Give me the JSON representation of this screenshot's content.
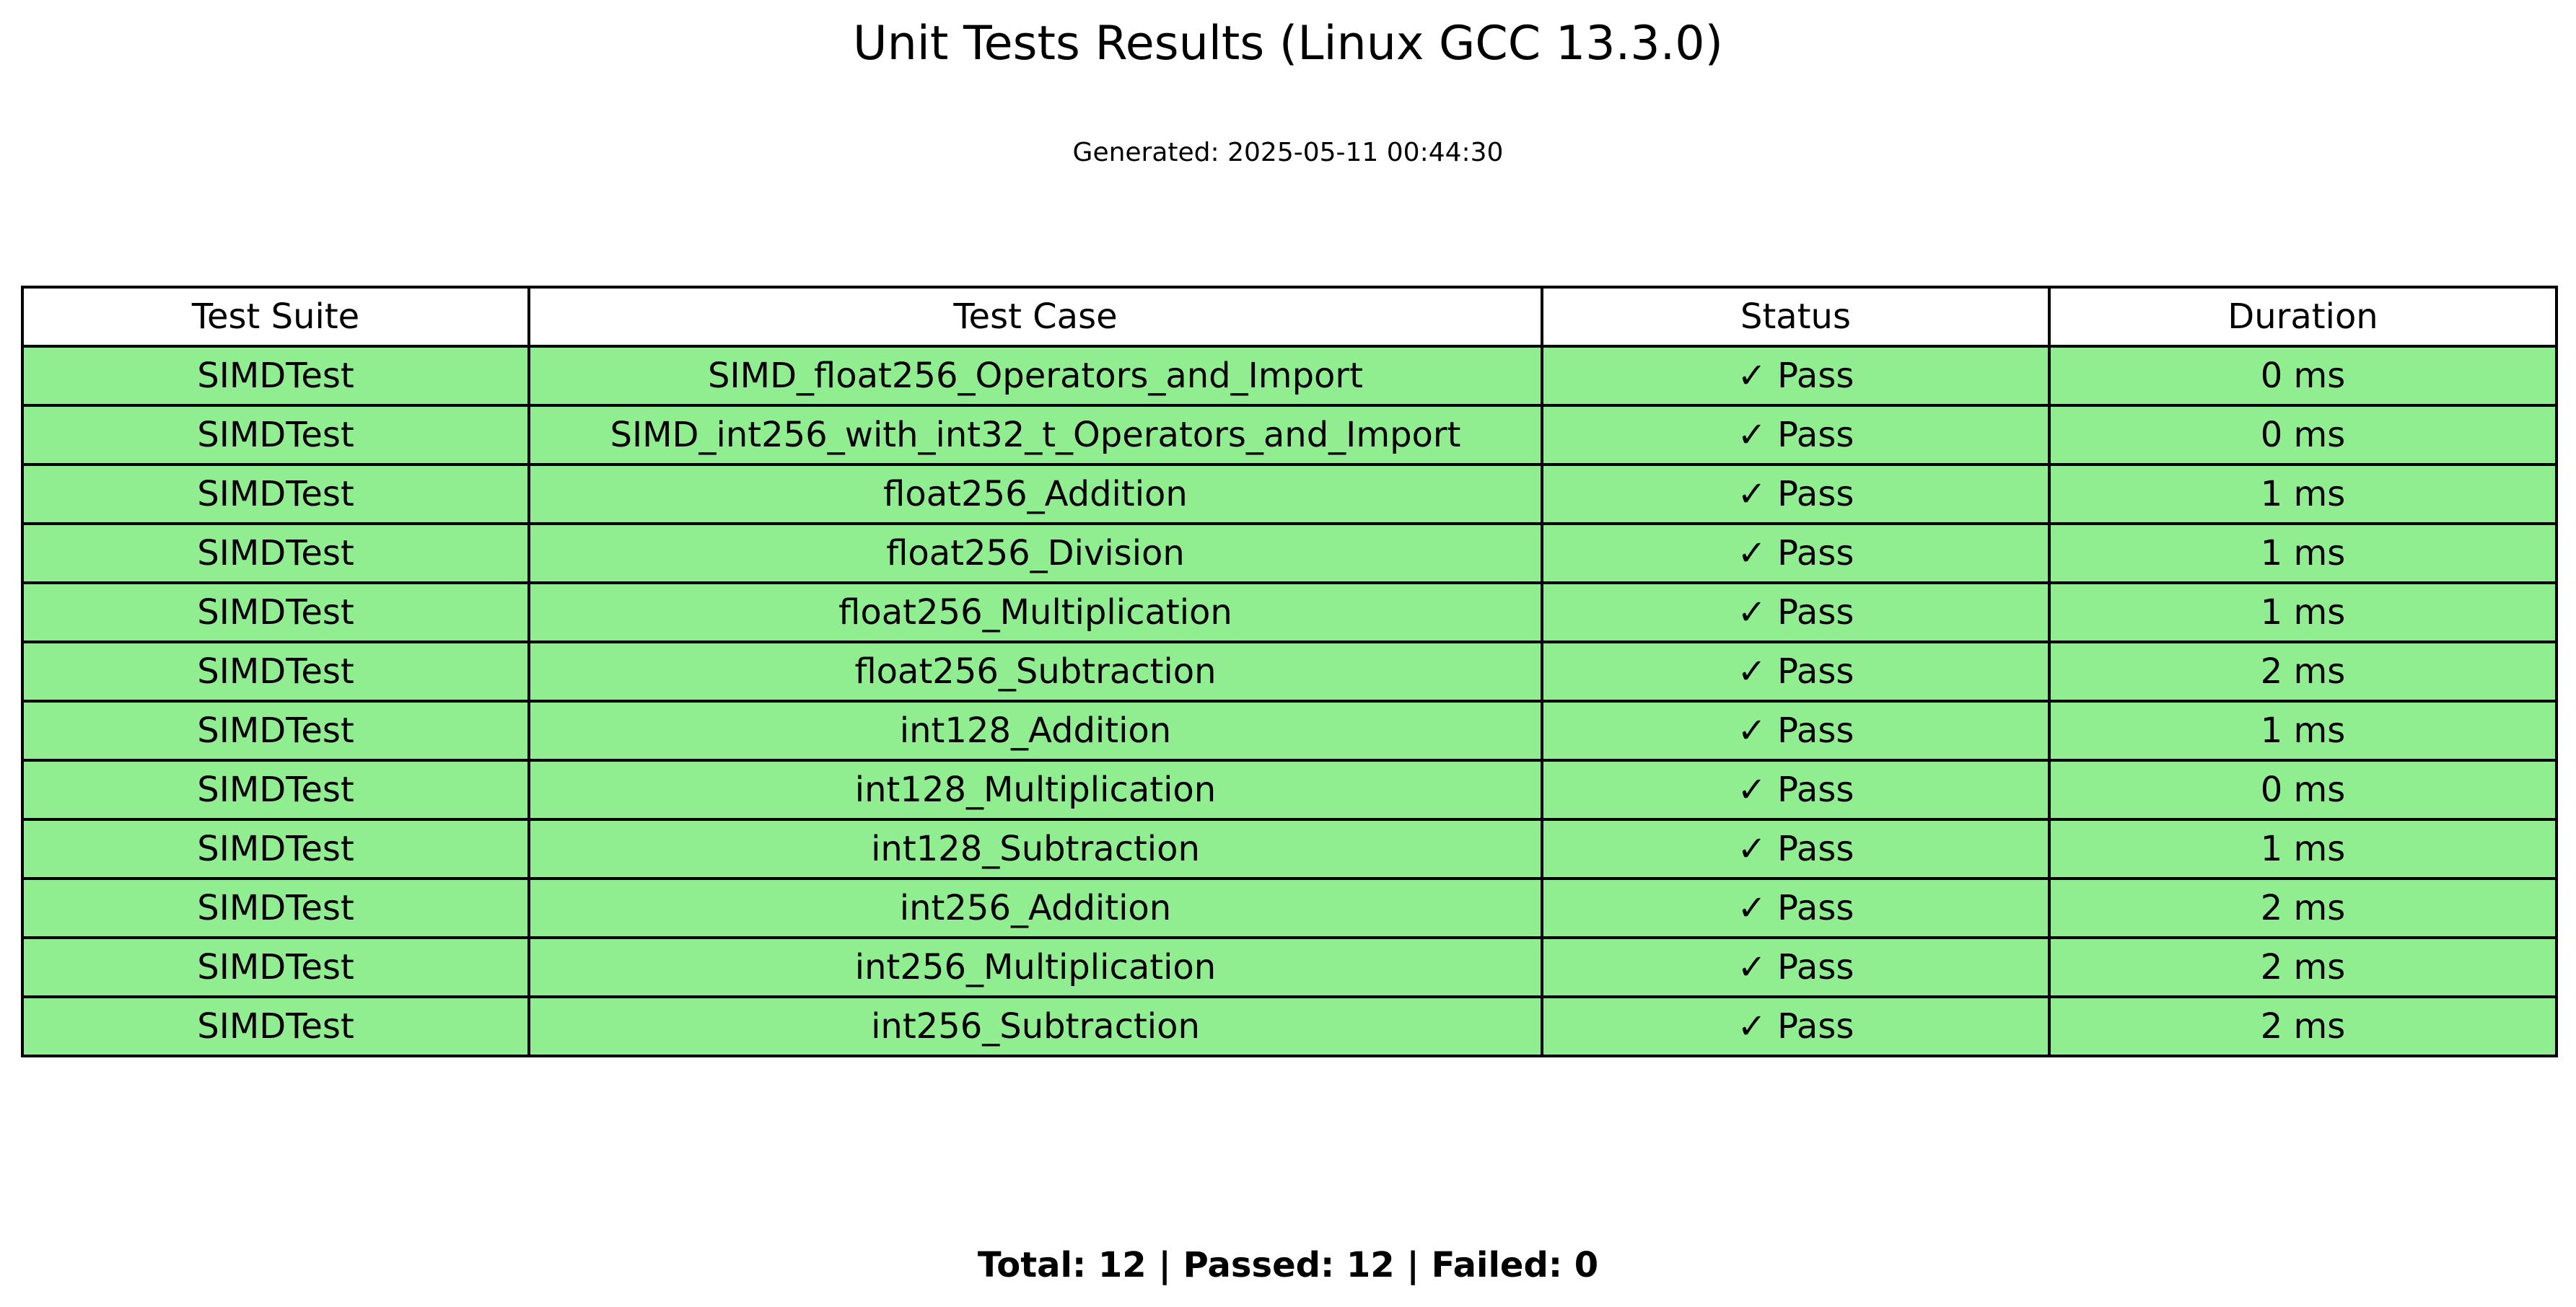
{
  "chart_data": {
    "type": "table",
    "title": "Unit Tests Results (Linux GCC 13.3.0)",
    "subtitle": "Generated: 2025-05-11 00:44:30",
    "columns": [
      "Test Suite",
      "Test Case",
      "Status",
      "Duration"
    ],
    "rows": [
      [
        "SIMDTest",
        "SIMD_float256_Operators_and_Import",
        "✓ Pass",
        "0 ms"
      ],
      [
        "SIMDTest",
        "SIMD_int256_with_int32_t_Operators_and_Import",
        "✓ Pass",
        "0 ms"
      ],
      [
        "SIMDTest",
        "float256_Addition",
        "✓ Pass",
        "1 ms"
      ],
      [
        "SIMDTest",
        "float256_Division",
        "✓ Pass",
        "1 ms"
      ],
      [
        "SIMDTest",
        "float256_Multiplication",
        "✓ Pass",
        "1 ms"
      ],
      [
        "SIMDTest",
        "float256_Subtraction",
        "✓ Pass",
        "2 ms"
      ],
      [
        "SIMDTest",
        "int128_Addition",
        "✓ Pass",
        "1 ms"
      ],
      [
        "SIMDTest",
        "int128_Multiplication",
        "✓ Pass",
        "0 ms"
      ],
      [
        "SIMDTest",
        "int128_Subtraction",
        "✓ Pass",
        "1 ms"
      ],
      [
        "SIMDTest",
        "int256_Addition",
        "✓ Pass",
        "2 ms"
      ],
      [
        "SIMDTest",
        "int256_Multiplication",
        "✓ Pass",
        "2 ms"
      ],
      [
        "SIMDTest",
        "int256_Subtraction",
        "✓ Pass",
        "2 ms"
      ]
    ],
    "summary": "Total: 12 | Passed: 12 | Failed: 0",
    "colors": {
      "pass_row": "#90ee90",
      "header": "#ffffff",
      "border": "#000000"
    }
  }
}
